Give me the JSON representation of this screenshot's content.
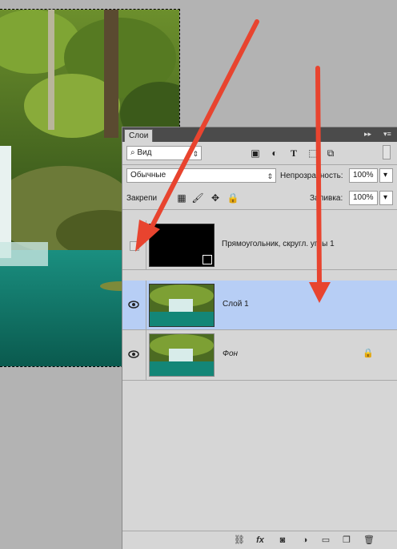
{
  "panel": {
    "tab_label": "Слои",
    "filter": {
      "label": "Вид",
      "options_visible": [
        "Вид"
      ]
    },
    "blend_mode": "Обычные",
    "opacity_label": "Непрозрачность:",
    "opacity_value": "100%",
    "lock_label": "Закрепи",
    "fill_label": "Заливка:",
    "fill_value": "100%",
    "layers": [
      {
        "name": "Прямоугольник, скругл. углы 1",
        "visible": false,
        "selected": false,
        "kind": "shape"
      },
      {
        "name": "Слой 1",
        "visible": true,
        "selected": true,
        "kind": "image"
      },
      {
        "name": "Фон",
        "visible": true,
        "selected": false,
        "kind": "image",
        "locked": true
      }
    ],
    "footer_icons": [
      "link-icon",
      "fx-icon",
      "mask-icon",
      "adjustment-icon",
      "folder-icon",
      "new-layer-icon",
      "trash-icon"
    ],
    "fx_label": "fx"
  },
  "colors": {
    "selected_row": "#b7cef5",
    "arrow": "#e8442f",
    "panel_bg": "#d6d6d6"
  }
}
